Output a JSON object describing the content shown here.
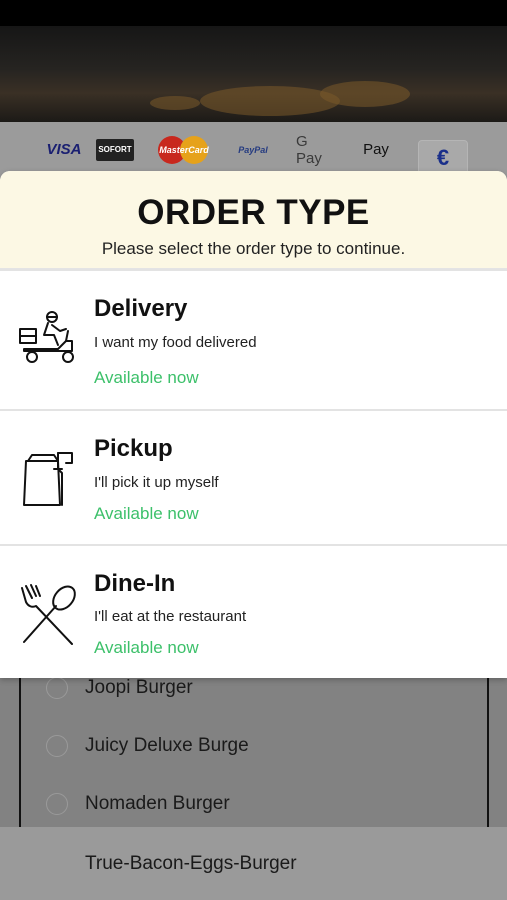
{
  "payment_methods": {
    "visa": "VISA",
    "sofort": "SOFORT",
    "mastercard": "MasterCard",
    "paypal": "PayPal",
    "gpay": "G Pay",
    "applepay": " Pay",
    "currency": "€"
  },
  "modal": {
    "title": "ORDER TYPE",
    "subtitle": "Please select the order type to continue.",
    "options": [
      {
        "icon": "delivery-scooter-icon",
        "title": "Delivery",
        "description": "I want my food delivered",
        "status": "Available now"
      },
      {
        "icon": "pickup-bag-icon",
        "title": "Pickup",
        "description": "I'll pick it up myself",
        "status": "Available now"
      },
      {
        "icon": "dine-in-cutlery-icon",
        "title": "Dine-In",
        "description": "I'll eat at the restaurant",
        "status": "Available now"
      }
    ]
  },
  "menu_items": [
    "Joopi Burger",
    "Juicy Deluxe Burge",
    "Nomaden Burger",
    "True-Bacon-Eggs-Burger"
  ],
  "colors": {
    "accent_green": "#3cc06a",
    "header_bg": "#fcf8e4",
    "overlay": "#8a8a8a"
  }
}
